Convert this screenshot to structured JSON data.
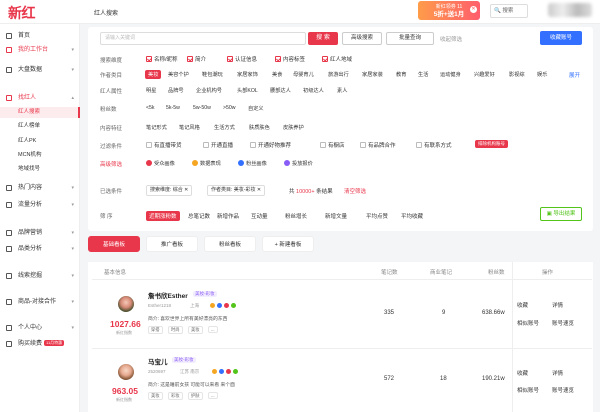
{
  "app": {
    "logo": "新红",
    "page_title": "红人搜索"
  },
  "promo": {
    "line1": "新红领劵 11",
    "line2": "5折+送1月",
    "close": "✕"
  },
  "top_search": {
    "label": "搜索"
  },
  "sidebar": {
    "items": [
      {
        "label": "首页"
      },
      {
        "label": "我的工作台"
      },
      {
        "label": "大盘数据"
      },
      {
        "label": "找红人"
      },
      {
        "label": "热门内容"
      },
      {
        "label": "流量分析"
      },
      {
        "label": "品牌营销"
      },
      {
        "label": "品类分析"
      },
      {
        "label": "线索挖掘"
      },
      {
        "label": "商品-对接合作"
      },
      {
        "label": "个人中心"
      },
      {
        "label": "购买续费"
      }
    ],
    "sub_items": [
      "红人搜索",
      "红人榜单",
      "红人PK",
      "MCN机构",
      "地域找号"
    ],
    "purchase_tag": "11月特惠"
  },
  "search": {
    "placeholder": "请输入关键词",
    "search_btn": "搜 索",
    "advanced_btn": "高级搜索",
    "batch_btn": "批量查询",
    "collect_text": "收起筛选",
    "collect_account_btn": "收藏账号"
  },
  "filters": {
    "search_scope": {
      "label": "搜索维度",
      "options": [
        "名称/昵称",
        "简介",
        "认证信息",
        "内容标签",
        "红人地域"
      ]
    },
    "category": {
      "label": "作者类目",
      "options": [
        "美妆",
        "美容个护",
        "鞋包潮玩",
        "家居家饰",
        "美食",
        "母婴育儿",
        "旅游出行",
        "家居家装",
        "教育",
        "生活",
        "运动健身",
        "兴趣爱好",
        "影视综",
        "娱乐"
      ],
      "expand": "展开"
    },
    "attribute": {
      "label": "红人属性",
      "options": [
        "明星",
        "品牌号",
        "企业机构号",
        "头部KOL",
        "腰部达人",
        "初级达人",
        "素人"
      ]
    },
    "fans": {
      "label": "粉丝数",
      "options": [
        "<5k",
        "5k-5w",
        "5w-50w",
        ">50w",
        "自定义"
      ]
    },
    "feature": {
      "label": "内容特征",
      "options": [
        "笔记形式",
        "笔记风格",
        "生活方式",
        "肤质肤色",
        "皮肤养护"
      ]
    },
    "filter": {
      "label": "过滤条件",
      "options": [
        "有直播带货",
        "开通直播",
        "开通好物推荐",
        "有橱店",
        "有品牌合作",
        "有联系方式",
        "排除机构账号"
      ]
    },
    "advanced": {
      "label": "高级筛选",
      "options": [
        "受众画像",
        "数据表现",
        "粉丝画像",
        "投放报价"
      ]
    }
  },
  "selected": {
    "label": "已选条件",
    "tags": [
      "搜索维度: 综合 ✕",
      "作者类目: 美妆-彩妆 ✕"
    ],
    "count_prefix": "共",
    "count": "10000+",
    "count_suffix": "条结果",
    "clear": "清空筛选"
  },
  "sort": {
    "label": "筛 序",
    "options": [
      "近期涨粉数",
      "总笔记数",
      "新增作品",
      "互动量",
      "粉丝增长",
      "新增文量",
      "平均点赞",
      "平均收藏"
    ],
    "export": "导出结果"
  },
  "tabs": [
    "基础看板",
    "推广看板",
    "粉丝看板",
    "+ 新建看板"
  ],
  "table": {
    "headers": [
      "基本信息",
      "笔记数",
      "商业笔记",
      "粉丝数",
      "操作"
    ],
    "rows": [
      {
        "name": "詹书欣Esther",
        "tag": "美妆-彩妆",
        "score": "1027.66",
        "score_label": "新红指数",
        "id": "Esther1218",
        "region": "上海",
        "desc": "简介: 喜欢世界上所有美好漂亮的东西",
        "chips": [
          "穿搭",
          "时尚",
          "美妆",
          "..."
        ],
        "notes": "335",
        "commercial": "9",
        "fans": "638.66w",
        "ops": [
          "收藏",
          "详情",
          "相似账号",
          "账号速览"
        ]
      },
      {
        "name": "马宝儿",
        "tag": "美妆-彩妆",
        "score": "963.05",
        "score_label": "新红指数",
        "id": "2520697",
        "region": "江苏 南京",
        "desc": "简介: 这是睡前女孩 可能可以来看 来个面",
        "chips": [
          "美妆",
          "彩妆",
          "护肤",
          "..."
        ],
        "notes": "572",
        "commercial": "18",
        "fans": "190.21w",
        "ops": [
          "收藏",
          "详情",
          "相似账号",
          "账号速览"
        ]
      }
    ]
  },
  "colors": {
    "brand": "#e8364a",
    "blue": "#3370ff",
    "green": "#52c41a"
  }
}
